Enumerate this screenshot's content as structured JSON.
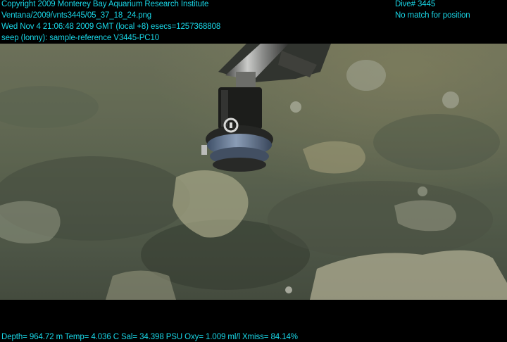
{
  "header": {
    "copyright": "Copyright 2009 Monterey Bay Aquarium Research Institute",
    "file_path": "Ventana/2009/vnts3445/05_37_18_24.png",
    "timestamp": "Wed Nov  4 21:06:48 2009 GMT (local +8)  esecs=1257368808",
    "site_label": "seep (lonny): sample-reference V3445-PC10",
    "dive": "Dive# 3445",
    "position_status": "No match for position"
  },
  "footer": {
    "telemetry": "Depth= 964.72 m  Temp= 4.036 C  Sal= 34.398 PSU  Oxy= 1.009 ml/l  Xmiss= 84.14%"
  },
  "colors": {
    "overlay_text": "#19d6e6",
    "background": "#000000",
    "seafloor": "#5a6450"
  },
  "icons": {
    "sampler_marking": "ring-marker-icon"
  }
}
